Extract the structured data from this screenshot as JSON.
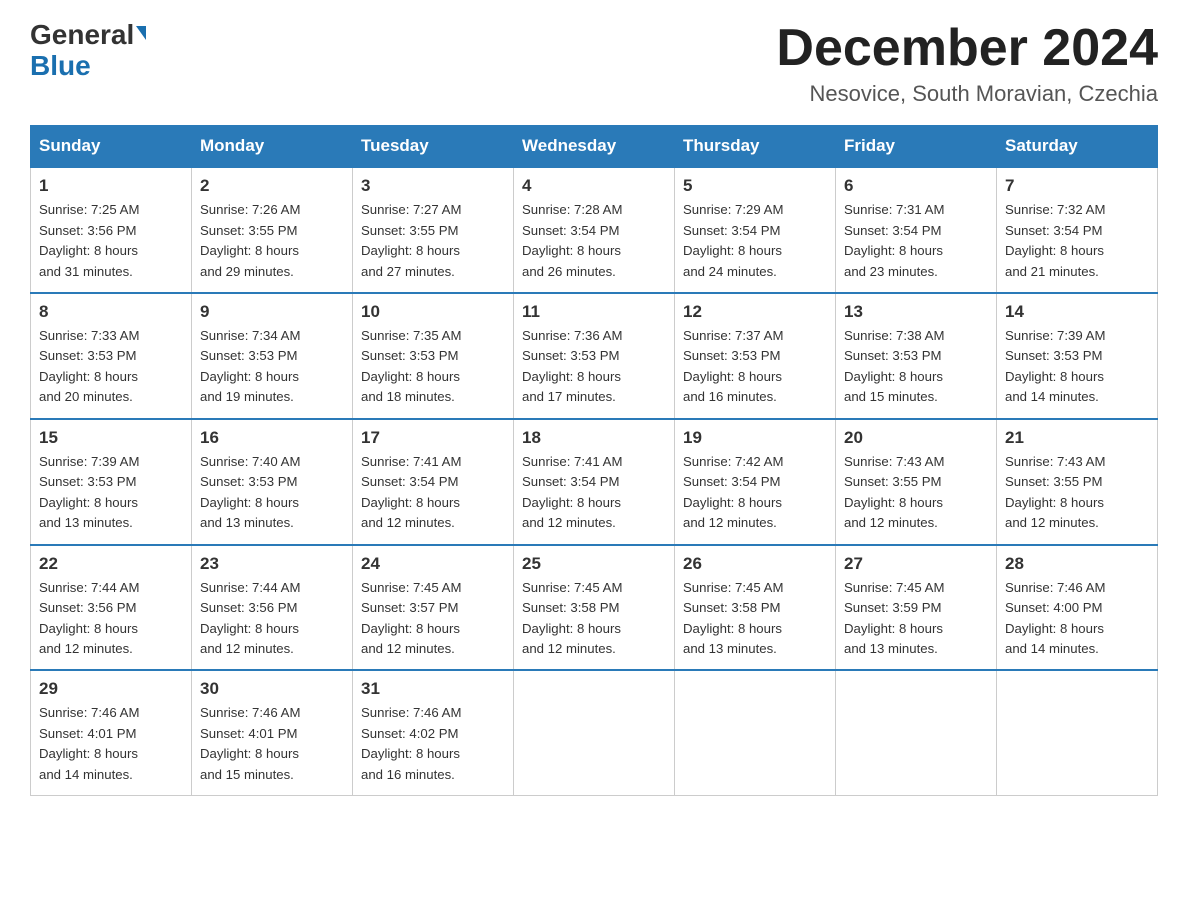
{
  "header": {
    "logo_general": "General",
    "logo_blue": "Blue",
    "month_title": "December 2024",
    "location": "Nesovice, South Moravian, Czechia"
  },
  "weekdays": [
    "Sunday",
    "Monday",
    "Tuesday",
    "Wednesday",
    "Thursday",
    "Friday",
    "Saturday"
  ],
  "weeks": [
    [
      {
        "day": "1",
        "sunrise": "7:25 AM",
        "sunset": "3:56 PM",
        "daylight": "8 hours and 31 minutes."
      },
      {
        "day": "2",
        "sunrise": "7:26 AM",
        "sunset": "3:55 PM",
        "daylight": "8 hours and 29 minutes."
      },
      {
        "day": "3",
        "sunrise": "7:27 AM",
        "sunset": "3:55 PM",
        "daylight": "8 hours and 27 minutes."
      },
      {
        "day": "4",
        "sunrise": "7:28 AM",
        "sunset": "3:54 PM",
        "daylight": "8 hours and 26 minutes."
      },
      {
        "day": "5",
        "sunrise": "7:29 AM",
        "sunset": "3:54 PM",
        "daylight": "8 hours and 24 minutes."
      },
      {
        "day": "6",
        "sunrise": "7:31 AM",
        "sunset": "3:54 PM",
        "daylight": "8 hours and 23 minutes."
      },
      {
        "day": "7",
        "sunrise": "7:32 AM",
        "sunset": "3:54 PM",
        "daylight": "8 hours and 21 minutes."
      }
    ],
    [
      {
        "day": "8",
        "sunrise": "7:33 AM",
        "sunset": "3:53 PM",
        "daylight": "8 hours and 20 minutes."
      },
      {
        "day": "9",
        "sunrise": "7:34 AM",
        "sunset": "3:53 PM",
        "daylight": "8 hours and 19 minutes."
      },
      {
        "day": "10",
        "sunrise": "7:35 AM",
        "sunset": "3:53 PM",
        "daylight": "8 hours and 18 minutes."
      },
      {
        "day": "11",
        "sunrise": "7:36 AM",
        "sunset": "3:53 PM",
        "daylight": "8 hours and 17 minutes."
      },
      {
        "day": "12",
        "sunrise": "7:37 AM",
        "sunset": "3:53 PM",
        "daylight": "8 hours and 16 minutes."
      },
      {
        "day": "13",
        "sunrise": "7:38 AM",
        "sunset": "3:53 PM",
        "daylight": "8 hours and 15 minutes."
      },
      {
        "day": "14",
        "sunrise": "7:39 AM",
        "sunset": "3:53 PM",
        "daylight": "8 hours and 14 minutes."
      }
    ],
    [
      {
        "day": "15",
        "sunrise": "7:39 AM",
        "sunset": "3:53 PM",
        "daylight": "8 hours and 13 minutes."
      },
      {
        "day": "16",
        "sunrise": "7:40 AM",
        "sunset": "3:53 PM",
        "daylight": "8 hours and 13 minutes."
      },
      {
        "day": "17",
        "sunrise": "7:41 AM",
        "sunset": "3:54 PM",
        "daylight": "8 hours and 12 minutes."
      },
      {
        "day": "18",
        "sunrise": "7:41 AM",
        "sunset": "3:54 PM",
        "daylight": "8 hours and 12 minutes."
      },
      {
        "day": "19",
        "sunrise": "7:42 AM",
        "sunset": "3:54 PM",
        "daylight": "8 hours and 12 minutes."
      },
      {
        "day": "20",
        "sunrise": "7:43 AM",
        "sunset": "3:55 PM",
        "daylight": "8 hours and 12 minutes."
      },
      {
        "day": "21",
        "sunrise": "7:43 AM",
        "sunset": "3:55 PM",
        "daylight": "8 hours and 12 minutes."
      }
    ],
    [
      {
        "day": "22",
        "sunrise": "7:44 AM",
        "sunset": "3:56 PM",
        "daylight": "8 hours and 12 minutes."
      },
      {
        "day": "23",
        "sunrise": "7:44 AM",
        "sunset": "3:56 PM",
        "daylight": "8 hours and 12 minutes."
      },
      {
        "day": "24",
        "sunrise": "7:45 AM",
        "sunset": "3:57 PM",
        "daylight": "8 hours and 12 minutes."
      },
      {
        "day": "25",
        "sunrise": "7:45 AM",
        "sunset": "3:58 PM",
        "daylight": "8 hours and 12 minutes."
      },
      {
        "day": "26",
        "sunrise": "7:45 AM",
        "sunset": "3:58 PM",
        "daylight": "8 hours and 13 minutes."
      },
      {
        "day": "27",
        "sunrise": "7:45 AM",
        "sunset": "3:59 PM",
        "daylight": "8 hours and 13 minutes."
      },
      {
        "day": "28",
        "sunrise": "7:46 AM",
        "sunset": "4:00 PM",
        "daylight": "8 hours and 14 minutes."
      }
    ],
    [
      {
        "day": "29",
        "sunrise": "7:46 AM",
        "sunset": "4:01 PM",
        "daylight": "8 hours and 14 minutes."
      },
      {
        "day": "30",
        "sunrise": "7:46 AM",
        "sunset": "4:01 PM",
        "daylight": "8 hours and 15 minutes."
      },
      {
        "day": "31",
        "sunrise": "7:46 AM",
        "sunset": "4:02 PM",
        "daylight": "8 hours and 16 minutes."
      },
      null,
      null,
      null,
      null
    ]
  ],
  "labels": {
    "sunrise": "Sunrise:",
    "sunset": "Sunset:",
    "daylight": "Daylight:"
  }
}
